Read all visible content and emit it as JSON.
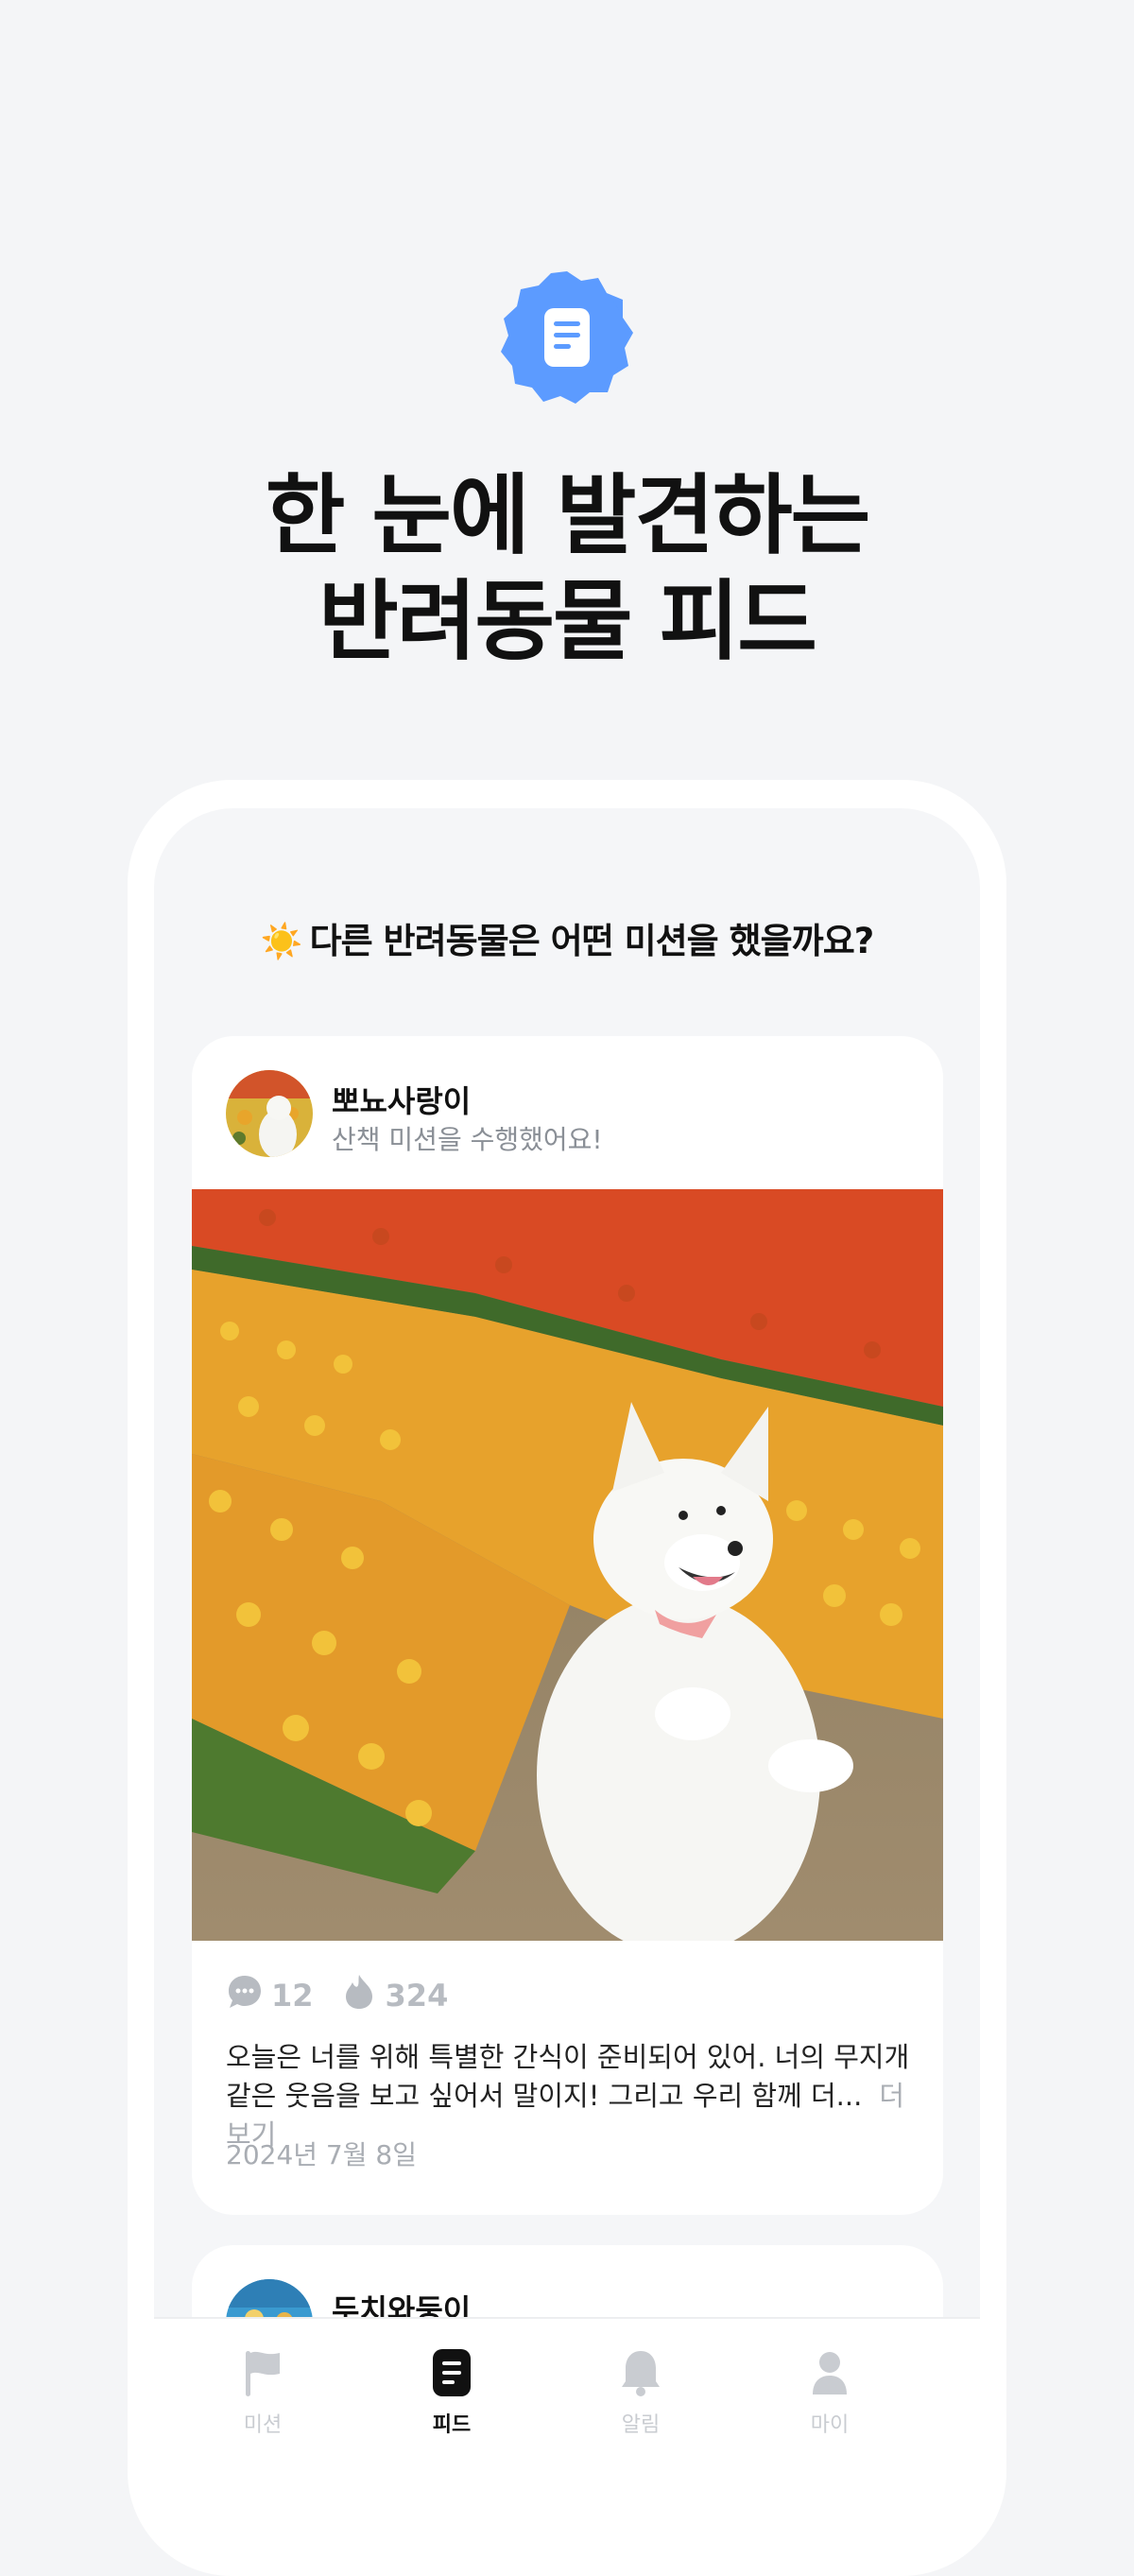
{
  "hero": {
    "badge_icon": "document-icon",
    "title_line1": "한 눈에 발견하는",
    "title_line2": "반려동물 피드"
  },
  "feed": {
    "heading_icon": "☀️",
    "heading": "다른 반려동물은 어떤 미션을 했을까요?",
    "posts": [
      {
        "user": "뽀뇨사랑이",
        "subtitle": "산책 미션을 수행했어요!",
        "comments": "12",
        "likes": "324",
        "caption": "오늘은 너를 위해 특별한 간식이 준비되어 있어. 너의 무지개 같은 웃음을 보고 싶어서 말이지! 그리고 우리 함께 더...",
        "more": "더 보기",
        "date": "2024년 7월 8일"
      },
      {
        "user": "두치와둥이"
      }
    ]
  },
  "tabbar": {
    "items": [
      {
        "label": "미션",
        "icon": "flag-icon",
        "active": false
      },
      {
        "label": "피드",
        "icon": "feed-icon",
        "active": true
      },
      {
        "label": "알림",
        "icon": "bell-icon",
        "active": false
      },
      {
        "label": "마이",
        "icon": "person-icon",
        "active": false
      }
    ]
  },
  "colors": {
    "background": "#F4F5F7",
    "accent": "#5C9BFF",
    "muted": "#B7BBC1",
    "text": "#111111"
  }
}
